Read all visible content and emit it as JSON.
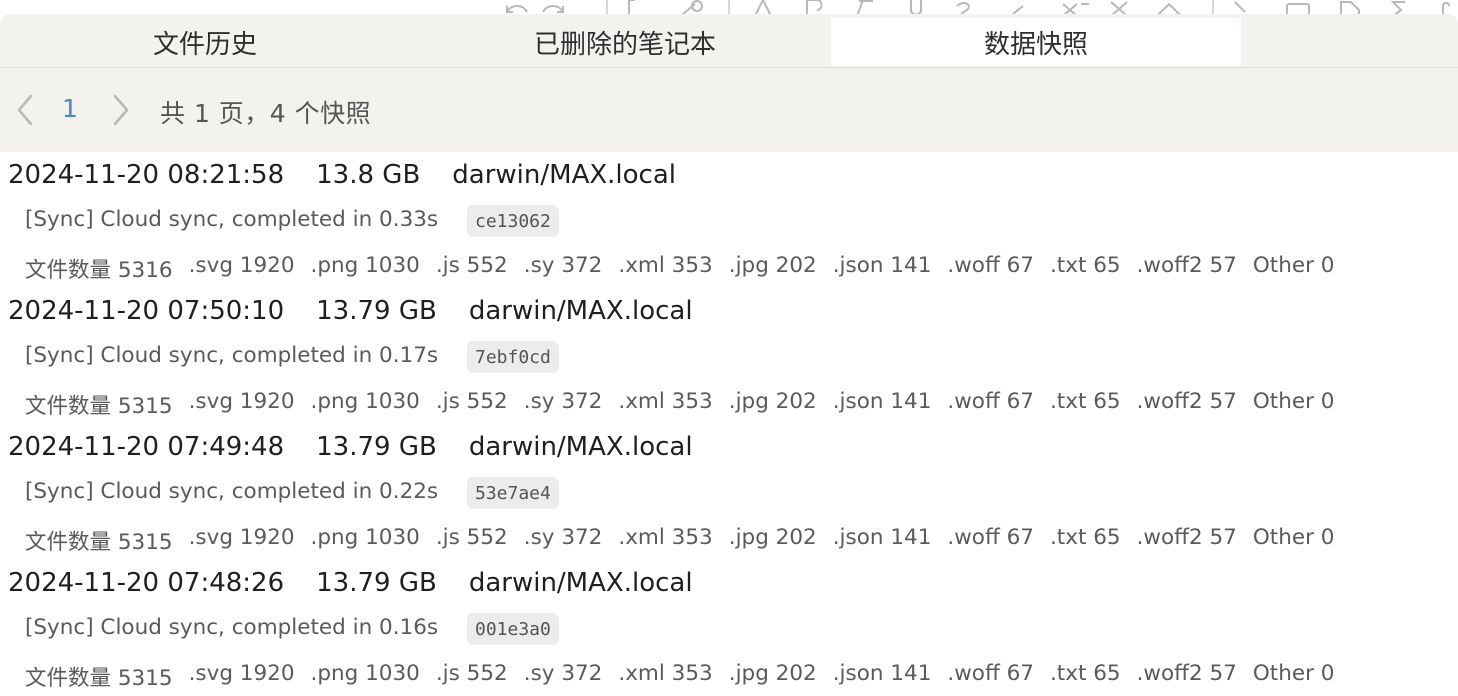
{
  "background_toolbar": {
    "icons": [
      "undo-icon",
      "redo-icon",
      "bracket-icon",
      "link-icon",
      "text-color-icon",
      "bold-icon",
      "italic-icon",
      "underline-icon",
      "strikethrough-icon",
      "slash-icon",
      "superscript-icon",
      "clear-format-icon",
      "chevron-up-icon",
      "chevron-right-icon",
      "box-icon",
      "doc-icon",
      "sigma-icon"
    ]
  },
  "tabs": [
    {
      "label": "文件历史",
      "active": false
    },
    {
      "label": "已删除的笔记本",
      "active": false
    },
    {
      "label": "数据快照",
      "active": true
    }
  ],
  "pager": {
    "prev_icon": "chevron-left-icon",
    "page": "1",
    "next_icon": "chevron-right-icon",
    "summary": "共 1 页，4 个快照"
  },
  "snapshots": [
    {
      "time": "2024-11-20 08:21:58",
      "size": "13.8 GB",
      "device": "darwin/MAX.local",
      "message": "[Sync] Cloud sync, completed in 0.33s",
      "hash": "ce13062",
      "stats": [
        "文件数量 5316",
        ".svg 1920",
        ".png 1030",
        ".js 552",
        ".sy 372",
        ".xml 353",
        ".jpg 202",
        ".json 141",
        ".woff 67",
        ".txt 65",
        ".woff2 57",
        "Other 0"
      ]
    },
    {
      "time": "2024-11-20 07:50:10",
      "size": "13.79 GB",
      "device": "darwin/MAX.local",
      "message": "[Sync] Cloud sync, completed in 0.17s",
      "hash": "7ebf0cd",
      "stats": [
        "文件数量 5315",
        ".svg 1920",
        ".png 1030",
        ".js 552",
        ".sy 372",
        ".xml 353",
        ".jpg 202",
        ".json 141",
        ".woff 67",
        ".txt 65",
        ".woff2 57",
        "Other 0"
      ]
    },
    {
      "time": "2024-11-20 07:49:48",
      "size": "13.79 GB",
      "device": "darwin/MAX.local",
      "message": "[Sync] Cloud sync, completed in 0.22s",
      "hash": "53e7ae4",
      "stats": [
        "文件数量 5315",
        ".svg 1920",
        ".png 1030",
        ".js 552",
        ".sy 372",
        ".xml 353",
        ".jpg 202",
        ".json 141",
        ".woff 67",
        ".txt 65",
        ".woff2 57",
        "Other 0"
      ]
    },
    {
      "time": "2024-11-20 07:48:26",
      "size": "13.79 GB",
      "device": "darwin/MAX.local",
      "message": "[Sync] Cloud sync, completed in 0.16s",
      "hash": "001e3a0",
      "stats": [
        "文件数量 5315",
        ".svg 1920",
        ".png 1030",
        ".js 552",
        ".sy 372",
        ".xml 353",
        ".jpg 202",
        ".json 141",
        ".woff 67",
        ".txt 65",
        ".woff2 57",
        "Other 0"
      ]
    }
  ],
  "colors": {
    "tab_bar_bg": "#f3f2ef",
    "active_tab_bg": "#ffffff",
    "page_link": "#4a84c9",
    "hash_badge_bg": "#ececec"
  }
}
